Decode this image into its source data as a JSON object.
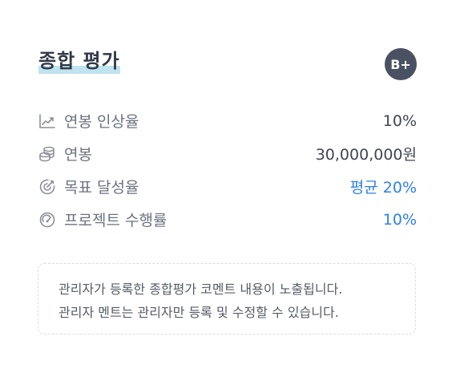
{
  "header": {
    "title": "종합 평가",
    "grade": "B+",
    "title_highlight_color": "#bfe3ef",
    "badge_color": "#4a5163"
  },
  "rows": [
    {
      "icon": "trending-up-icon",
      "label": "연봉 인상율",
      "value": "10%",
      "value_color": "#3f4654"
    },
    {
      "icon": "coins-icon",
      "label": "연봉",
      "value": "30,000,000원",
      "value_color": "#3f4654"
    },
    {
      "icon": "target-icon",
      "label": "목표 달성율",
      "value": "평균 20%",
      "value_color": "#2f80ed"
    },
    {
      "icon": "gauge-icon",
      "label": "프로젝트 수행률",
      "value": "10%",
      "value_color": "#2f80ed"
    }
  ],
  "note": {
    "lines": [
      "관리자가 등록한 종합평가 코멘트 내용이 노출됩니다.",
      "관리자 멘트는 관리자만 등록 및 수정할 수 있습니다."
    ]
  }
}
